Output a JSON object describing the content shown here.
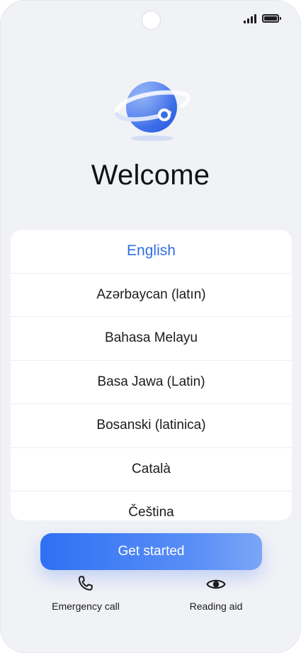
{
  "screen": {
    "title": "Welcome"
  },
  "languages": [
    {
      "label": "English",
      "selected": true
    },
    {
      "label": "Azərbaycan (latın)",
      "selected": false
    },
    {
      "label": "Bahasa Melayu",
      "selected": false
    },
    {
      "label": "Basa Jawa (Latin)",
      "selected": false
    },
    {
      "label": "Bosanski (latinica)",
      "selected": false
    },
    {
      "label": "Català",
      "selected": false
    },
    {
      "label": "Čeština",
      "selected": false
    }
  ],
  "actions": {
    "get_started_label": "Get started",
    "emergency_call_label": "Emergency call",
    "reading_aid_label": "Reading aid"
  },
  "icons": {
    "logo": "globe-orbit-icon",
    "emergency": "phone-icon",
    "reading": "eye-icon",
    "status_signal": "signal-icon",
    "status_battery": "battery-icon"
  },
  "colors": {
    "accent": "#2f6fe6",
    "button_start": "#2e70f4",
    "button_end": "#7aa6f7",
    "background": "#f1f2f6"
  }
}
